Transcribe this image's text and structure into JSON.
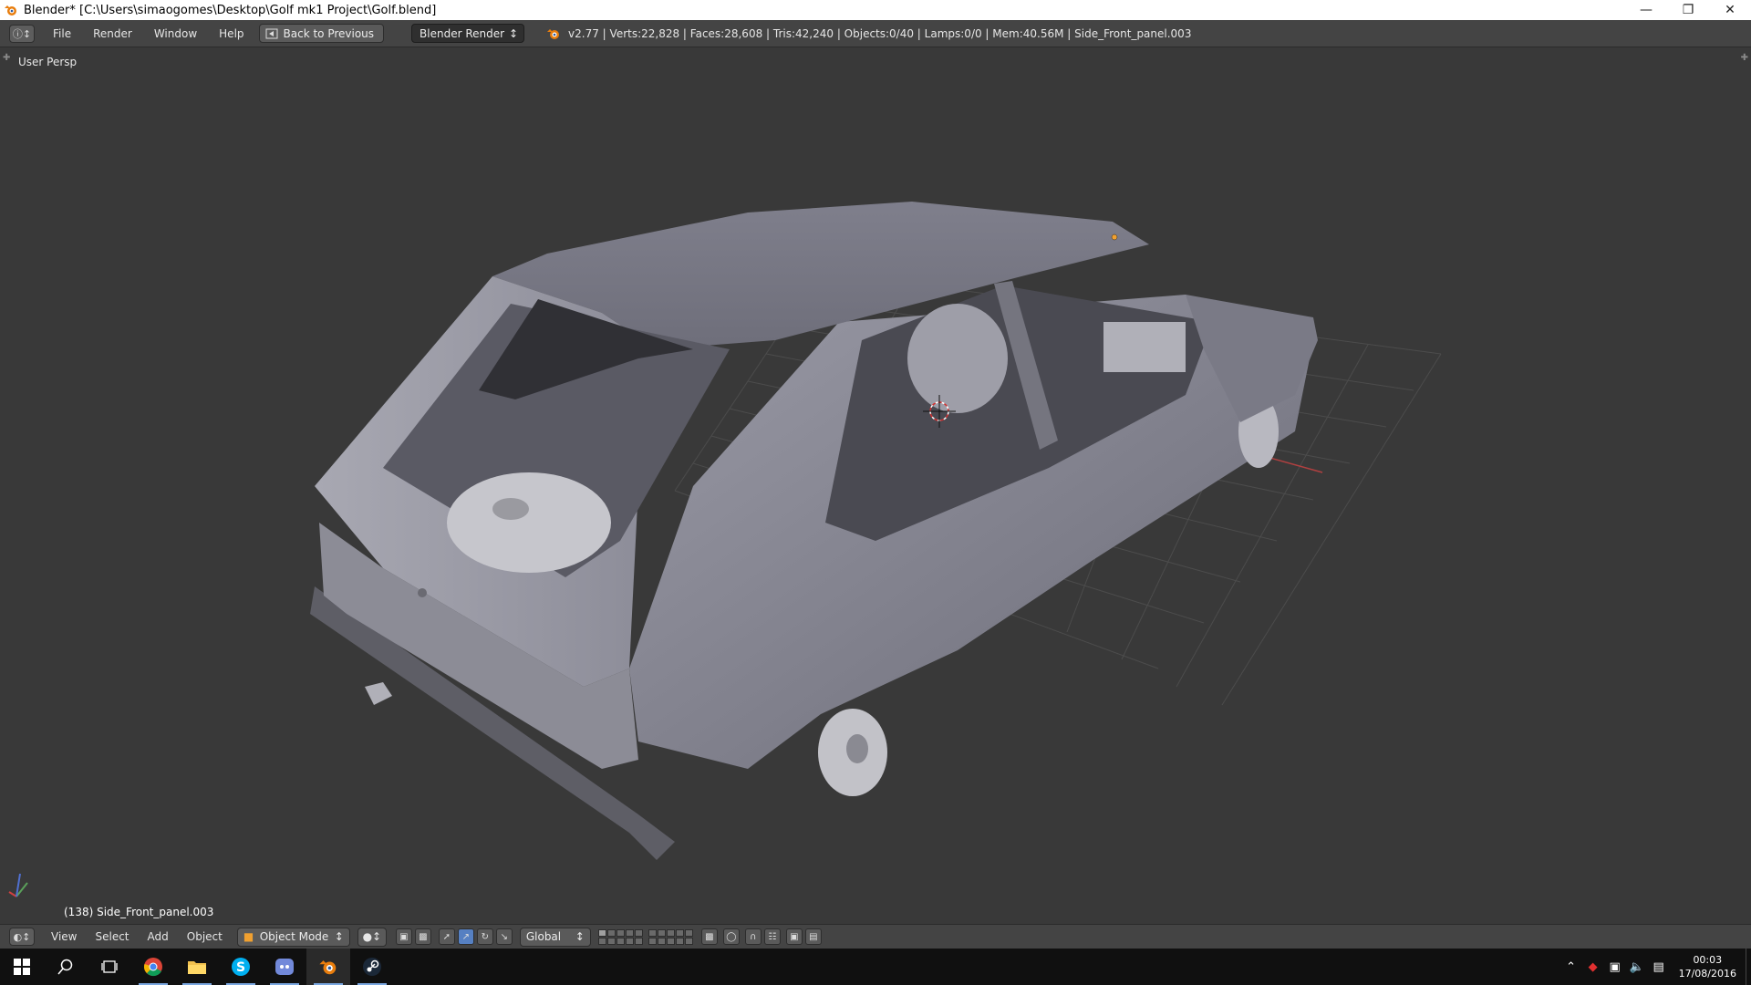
{
  "window": {
    "title": "Blender* [C:\\Users\\simaogomes\\Desktop\\Golf mk1 Project\\Golf.blend]",
    "minimize_icon": "minimize-icon",
    "restore_icon": "restore-icon",
    "close_icon": "close-icon"
  },
  "info_header": {
    "menus": [
      "File",
      "Render",
      "Window",
      "Help"
    ],
    "back_button": "Back to Previous",
    "render_engine": "Blender Render",
    "stats": "v2.77 | Verts:22,828 | Faces:28,608 | Tris:42,240 | Objects:0/40 | Lamps:0/0 | Mem:40.56M | Side_Front_panel.003"
  },
  "viewport": {
    "view_label": "User Persp",
    "object_label": "(138) Side_Front_panel.003"
  },
  "view3d_header": {
    "menus": [
      "View",
      "Select",
      "Add",
      "Object"
    ],
    "mode": "Object Mode",
    "orientation": "Global"
  },
  "taskbar": {
    "apps": [
      "windows-start-icon",
      "search-icon",
      "task-view-icon",
      "chrome-icon",
      "file-explorer-icon",
      "skype-icon",
      "discord-icon",
      "blender-icon",
      "steam-icon"
    ],
    "time": "00:03",
    "date": "17/08/2016"
  },
  "colors": {
    "ui_header": "#444444",
    "viewport_bg": "#393939",
    "mesh": "#8a8a96",
    "grid": "#4a4a4a",
    "x_axis": "#b04040",
    "y_axis": "#5aa05a"
  }
}
